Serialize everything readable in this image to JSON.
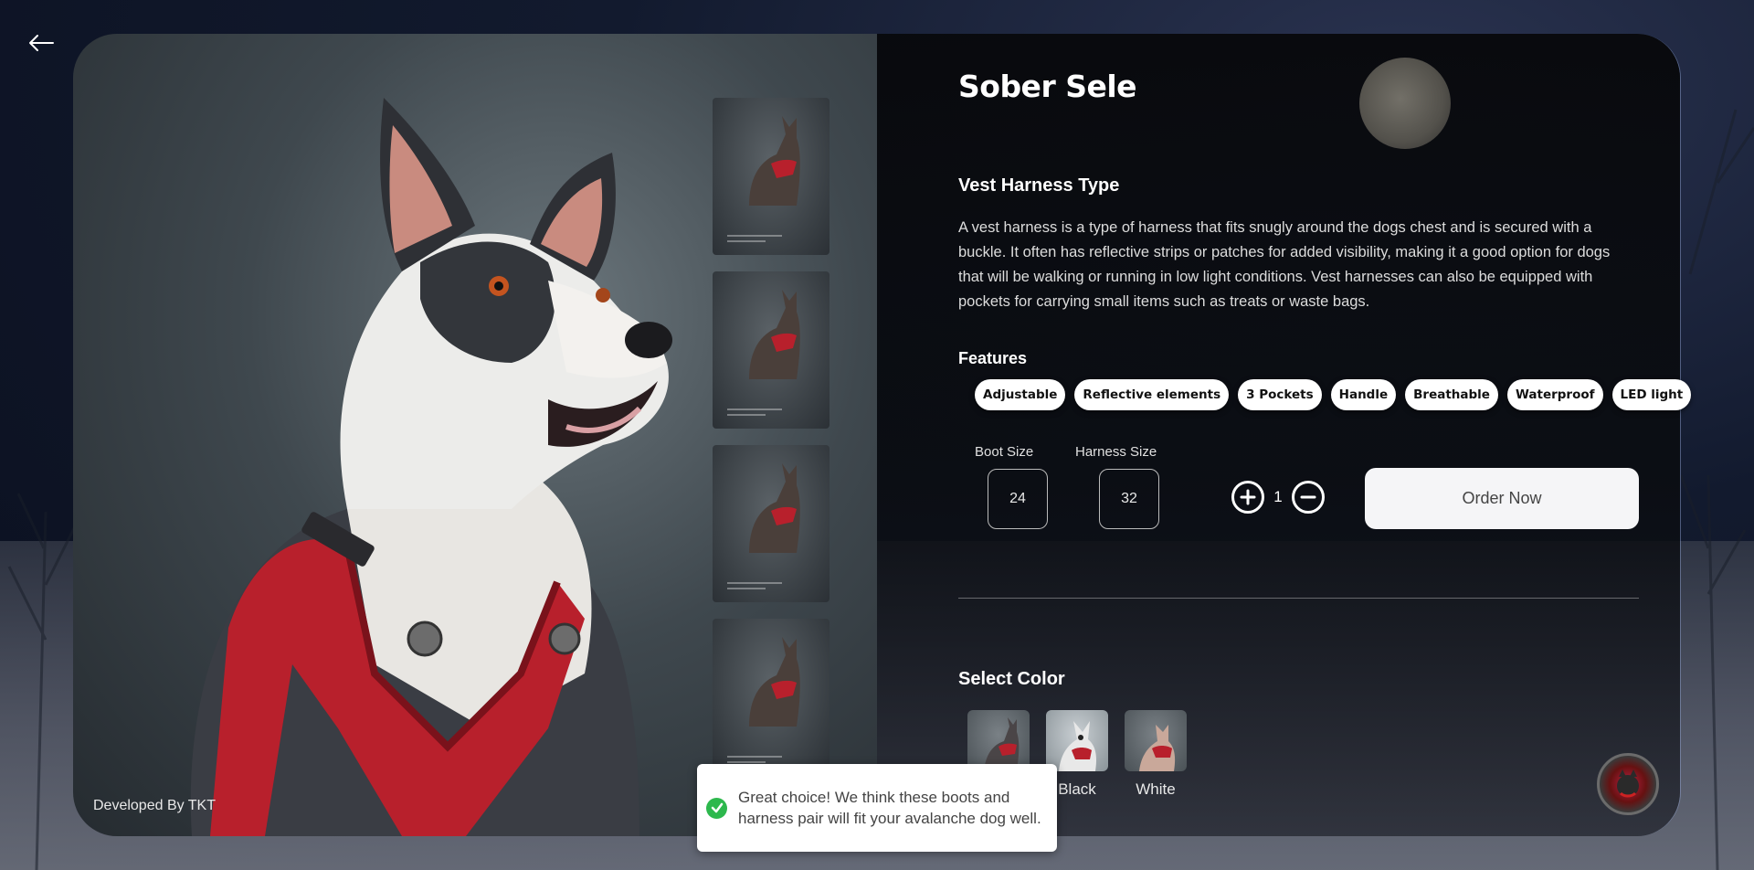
{
  "nav": {
    "back_icon": "arrow-left-icon"
  },
  "product": {
    "title": "Sober Sele",
    "type_heading": "Vest Harness Type",
    "description": "A vest harness is a type of harness that fits snugly around the dogs chest and is secured with a buckle. It often has reflective strips or patches for added visibility, making it a good option for dogs that will be walking or running in low light conditions. Vest harnesses can also be equipped with pockets for carrying small items such as treats or waste bags.",
    "features_label": "Features",
    "features": [
      "Adjustable",
      "Reflective elements",
      "3 Pockets",
      "Handle",
      "Breathable",
      "Waterproof",
      "LED light"
    ],
    "boot_size_label": "Boot Size",
    "boot_size": "24",
    "harness_size_label": "Harness Size",
    "harness_size": "32",
    "quantity": "1",
    "order_label": "Order Now",
    "select_color_label": "Select Color",
    "colors": [
      "Red",
      "Black",
      "White"
    ],
    "colors_visible": [
      "",
      "Black",
      "White"
    ]
  },
  "gallery": {
    "credit": "Developed By TKT",
    "thumbnail_count": 4
  },
  "toast": {
    "message": "Great choice! We think these boots and harness pair will fit your avalanche dog well."
  },
  "colors": {
    "harness_red": "#b8202c",
    "toast_success": "#2db84d",
    "order_button_bg": "#f5f5f7"
  }
}
